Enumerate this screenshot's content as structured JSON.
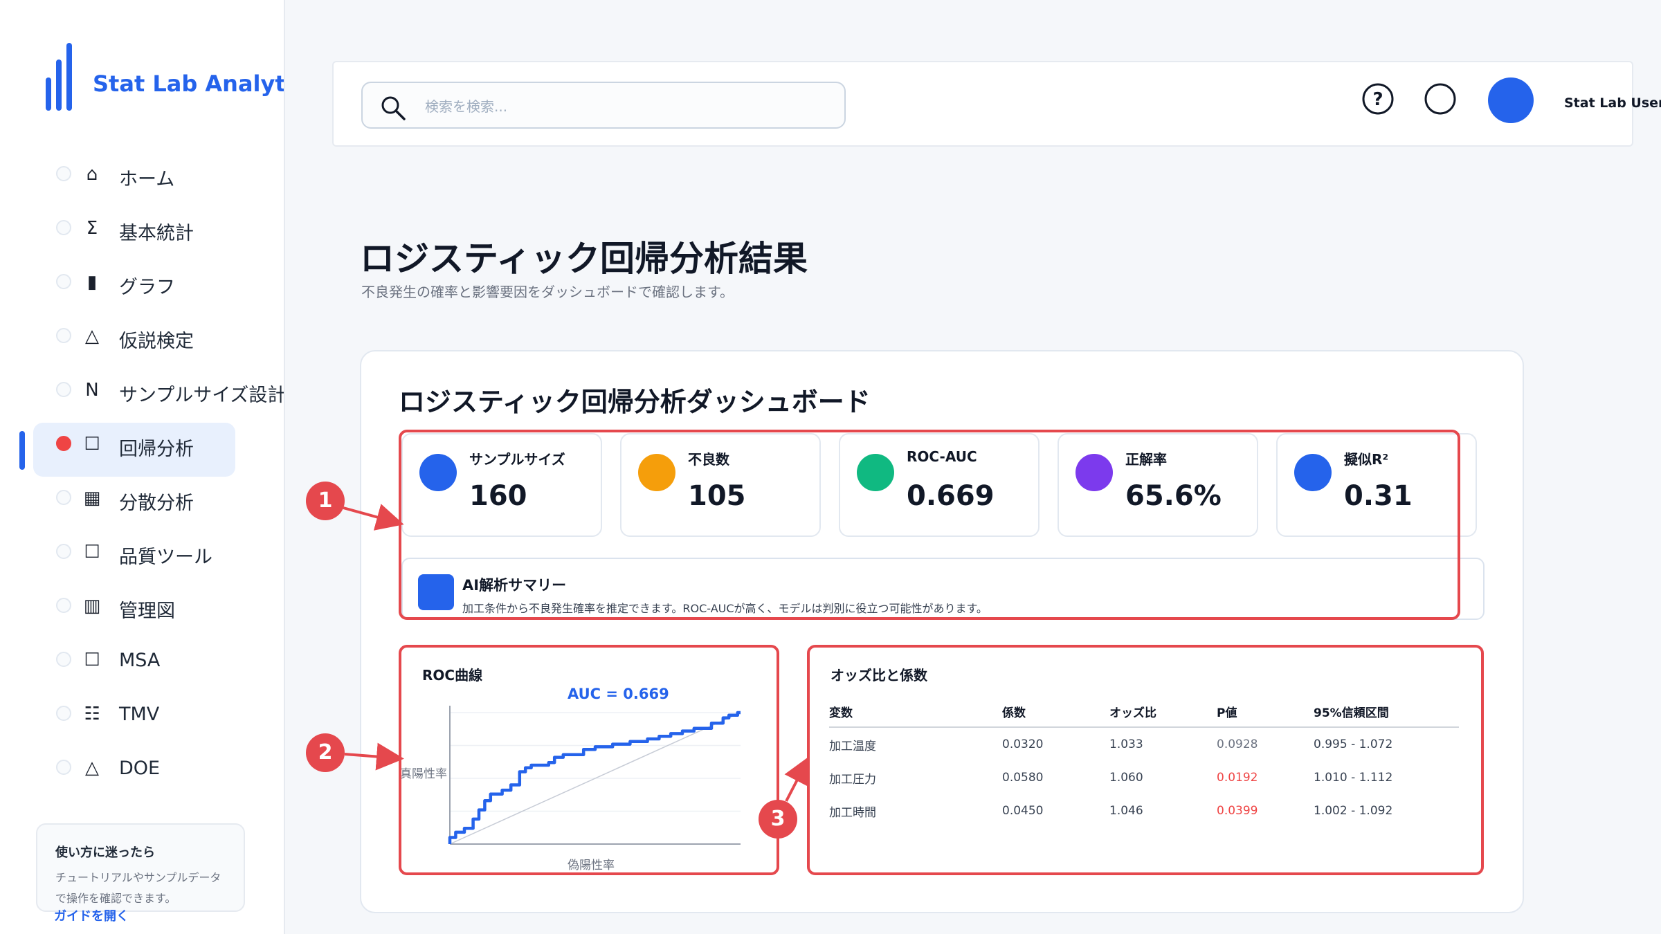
{
  "app": {
    "name": "Stat Lab Analytics"
  },
  "header": {
    "search_placeholder": "検索を検索...",
    "user_name": "Stat Lab User"
  },
  "sidebar": {
    "items": [
      {
        "icon": "⌂",
        "label": "ホーム"
      },
      {
        "icon": "Σ",
        "label": "基本統計"
      },
      {
        "icon": "▮",
        "label": "グラフ"
      },
      {
        "icon": "△",
        "label": "仮説検定"
      },
      {
        "icon": "N",
        "label": "サンプルサイズ設計"
      },
      {
        "icon": "☐",
        "label": "回帰分析"
      },
      {
        "icon": "▦",
        "label": "分散分析"
      },
      {
        "icon": "☐",
        "label": "品質ツール"
      },
      {
        "icon": "▥",
        "label": "管理図"
      },
      {
        "icon": "☐",
        "label": "MSA"
      },
      {
        "icon": "☷",
        "label": "TMV"
      },
      {
        "icon": "△",
        "label": "DOE"
      }
    ],
    "active_index": 5,
    "help": {
      "title": "使い方に迷ったら",
      "description": "チュートリアルやサンプルデータで操作を確認できます。",
      "link": "ガイドを開く"
    }
  },
  "page": {
    "title": "ロジスティック回帰分析結果",
    "subtitle": "不良発生の確率と影響要因をダッシュボードで確認します。"
  },
  "dashboard": {
    "title": "ロジスティック回帰分析ダッシュボード",
    "kpis": [
      {
        "label": "サンプルサイズ",
        "value": "160",
        "color": "#2563eb"
      },
      {
        "label": "不良数",
        "value": "105",
        "color": "#f59e0b"
      },
      {
        "label": "ROC-AUC",
        "value": "0.669",
        "color": "#10b981"
      },
      {
        "label": "正解率",
        "value": "65.6%",
        "color": "#7c3aed"
      },
      {
        "label": "擬似R²",
        "value": "0.31",
        "color": "#2563eb"
      }
    ],
    "summary": {
      "title": "AI解析サマリー",
      "text": "加工条件から不良発生確率を推定できます。ROC-AUCが高く、モデルは判別に役立つ可能性があります。"
    },
    "roc": {
      "title": "ROC曲線",
      "auc_label": "AUC = 0.669",
      "xlabel": "偽陽性率",
      "ylabel": "真陽性率"
    },
    "odds": {
      "title": "オッズ比と係数",
      "columns": [
        "変数",
        "係数",
        "オッズ比",
        "P値",
        "95%信頼区間"
      ],
      "rows": [
        {
          "var": "加工温度",
          "coef": "0.0320",
          "odds": "1.033",
          "p": "0.0928",
          "ci": "0.995 - 1.072",
          "significant": false
        },
        {
          "var": "加工圧力",
          "coef": "0.0580",
          "odds": "1.060",
          "p": "0.0192",
          "ci": "1.010 - 1.112",
          "significant": true
        },
        {
          "var": "加工時間",
          "coef": "0.0450",
          "odds": "1.046",
          "p": "0.0399",
          "ci": "1.002 - 1.092",
          "significant": true
        }
      ]
    }
  },
  "annotations": [
    "1",
    "2",
    "3"
  ],
  "chart_data": {
    "type": "line",
    "title": "ROC曲線",
    "xlabel": "偽陽性率",
    "ylabel": "真陽性率",
    "xlim": [
      0,
      1
    ],
    "ylim": [
      0,
      1
    ],
    "annotation": "AUC = 0.669",
    "series": [
      {
        "name": "ROC",
        "points": [
          [
            0,
            0
          ],
          [
            0,
            0.05
          ],
          [
            0.02,
            0.05
          ],
          [
            0.02,
            0.09
          ],
          [
            0.05,
            0.09
          ],
          [
            0.05,
            0.12
          ],
          [
            0.08,
            0.12
          ],
          [
            0.08,
            0.19
          ],
          [
            0.1,
            0.19
          ],
          [
            0.1,
            0.26
          ],
          [
            0.12,
            0.26
          ],
          [
            0.12,
            0.33
          ],
          [
            0.14,
            0.33
          ],
          [
            0.14,
            0.38
          ],
          [
            0.18,
            0.38
          ],
          [
            0.18,
            0.41
          ],
          [
            0.21,
            0.41
          ],
          [
            0.21,
            0.45
          ],
          [
            0.24,
            0.45
          ],
          [
            0.24,
            0.55
          ],
          [
            0.26,
            0.55
          ],
          [
            0.26,
            0.58
          ],
          [
            0.28,
            0.58
          ],
          [
            0.28,
            0.6
          ],
          [
            0.34,
            0.6
          ],
          [
            0.34,
            0.62
          ],
          [
            0.36,
            0.62
          ],
          [
            0.36,
            0.66
          ],
          [
            0.39,
            0.66
          ],
          [
            0.39,
            0.68
          ],
          [
            0.46,
            0.68
          ],
          [
            0.46,
            0.72
          ],
          [
            0.5,
            0.72
          ],
          [
            0.5,
            0.74
          ],
          [
            0.56,
            0.74
          ],
          [
            0.56,
            0.76
          ],
          [
            0.62,
            0.76
          ],
          [
            0.62,
            0.78
          ],
          [
            0.68,
            0.78
          ],
          [
            0.68,
            0.8
          ],
          [
            0.72,
            0.8
          ],
          [
            0.72,
            0.82
          ],
          [
            0.76,
            0.82
          ],
          [
            0.76,
            0.84
          ],
          [
            0.8,
            0.84
          ],
          [
            0.8,
            0.86
          ],
          [
            0.84,
            0.86
          ],
          [
            0.84,
            0.88
          ],
          [
            0.9,
            0.88
          ],
          [
            0.9,
            0.92
          ],
          [
            0.94,
            0.92
          ],
          [
            0.94,
            0.96
          ],
          [
            0.96,
            0.96
          ],
          [
            0.96,
            0.98
          ],
          [
            0.99,
            0.98
          ],
          [
            0.99,
            1.0
          ],
          [
            1.0,
            1.0
          ]
        ]
      },
      {
        "name": "diagonal",
        "points": [
          [
            0,
            0
          ],
          [
            1,
            1
          ]
        ]
      }
    ]
  }
}
